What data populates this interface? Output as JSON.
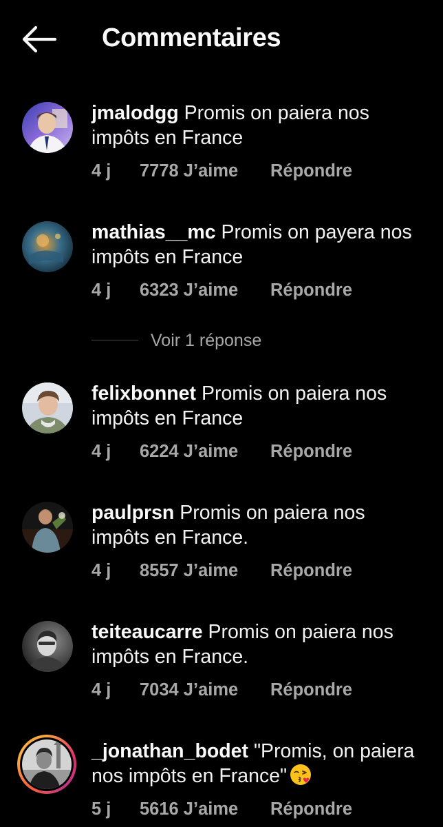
{
  "header": {
    "title": "Commentaires",
    "back_icon": "arrow-left-icon"
  },
  "comments": [
    {
      "username": "jmalodgg",
      "text": "Promis on paiera nos",
      "text2": "impôts en France",
      "age": "4 j",
      "likes": "7778 J’aime",
      "reply": "Répondre"
    },
    {
      "username": "mathias__mc",
      "text": "Promis on payera nos",
      "text2": "impôts en France",
      "age": "4 j",
      "likes": "6323 J’aime",
      "reply": "Répondre",
      "view_replies": "Voir 1 réponse"
    },
    {
      "username": "felixbonnet",
      "text": "Promis on paiera nos",
      "text2": "impôts en France",
      "age": "4 j",
      "likes": "6224 J’aime",
      "reply": "Répondre"
    },
    {
      "username": "paulprsn",
      "text": "Promis on paiera nos",
      "text2": "impôts en France.",
      "age": "4 j",
      "likes": "8557 J’aime",
      "reply": "Répondre"
    },
    {
      "username": "teiteaucarre",
      "text": "Promis on paiera nos",
      "text2": "impôts en France.",
      "age": "4 j",
      "likes": "7034 J’aime",
      "reply": "Répondre"
    },
    {
      "username": "_jonathan_bodet",
      "text": "\"Promis, on paiera",
      "text2": "nos impôts en France\"",
      "emoji": "kissing-face-emoji",
      "age": "5 j",
      "likes": "5616 J’aime",
      "reply": "Répondre",
      "has_story_ring": true
    }
  ],
  "colors": {
    "background": "#000000",
    "primary_text": "#f5f5f5",
    "secondary_text": "#a8a8a8",
    "divider": "#4a4a4a"
  }
}
